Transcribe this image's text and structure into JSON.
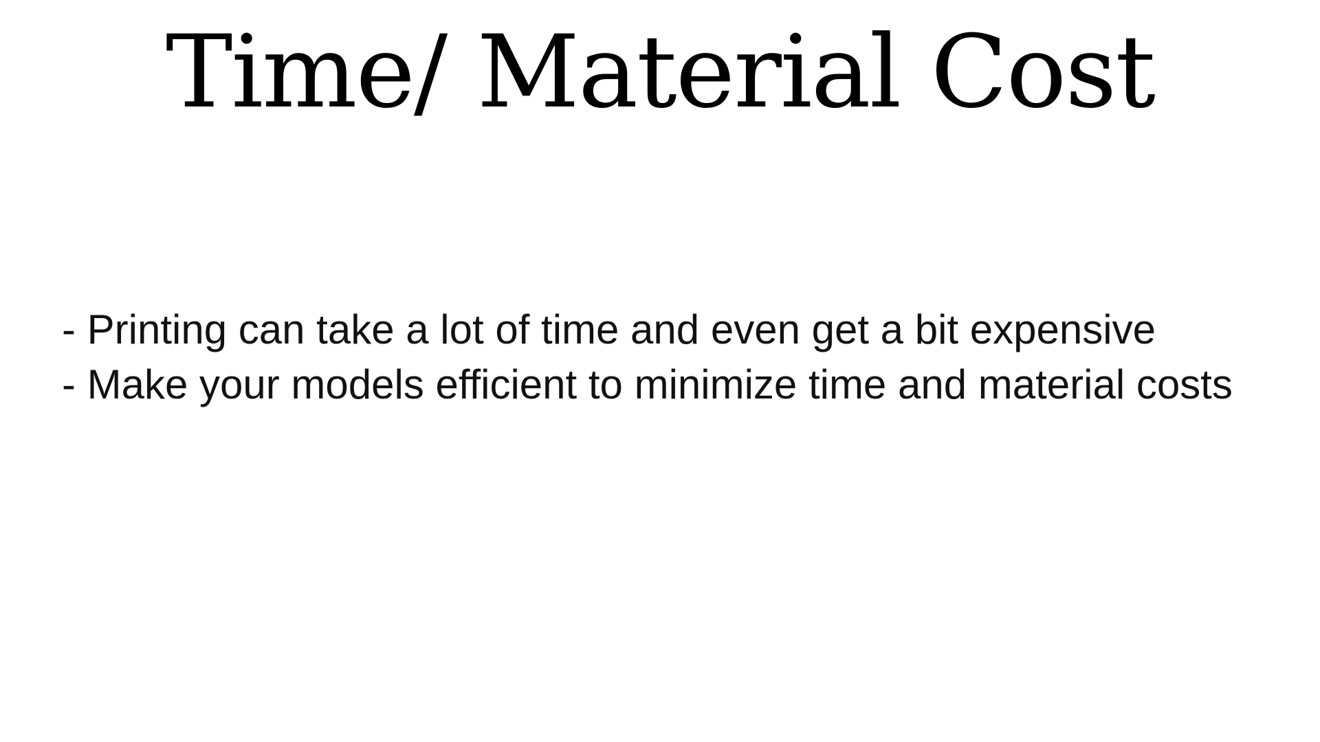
{
  "slide": {
    "title": "Time/ Material Cost",
    "bullets": [
      "- Printing can take a lot of time and even get a bit expensive",
      "- Make your models efficient to minimize time and material costs"
    ]
  }
}
